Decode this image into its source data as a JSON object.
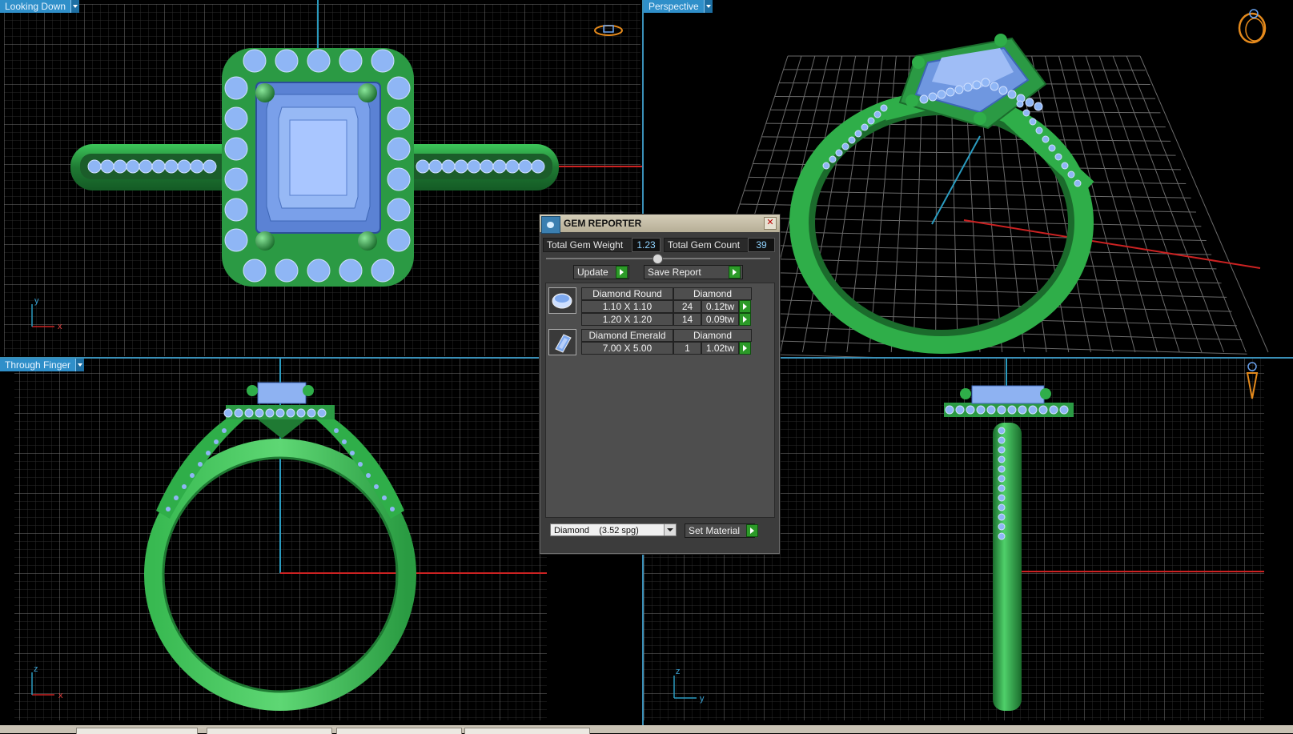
{
  "viewports": {
    "top_left": {
      "label": "Looking Down"
    },
    "top_right": {
      "label": "Perspective"
    },
    "bottom_left": {
      "label": "Through Finger"
    },
    "bottom_right": {
      "label": ""
    }
  },
  "axes": {
    "top_left": {
      "a": "y",
      "b": "x"
    },
    "bottom_left": {
      "a": "z",
      "b": "x"
    },
    "bottom_right": {
      "a": "z",
      "b": "y"
    }
  },
  "gem_reporter": {
    "title": "GEM REPORTER",
    "total_weight_label": "Total Gem Weight",
    "total_weight_value": "1.23",
    "total_count_label": "Total Gem Count",
    "total_count_value": "39",
    "update_label": "Update",
    "save_label": "Save Report",
    "groups": [
      {
        "name": "Diamond Round",
        "material": "Diamond",
        "rows": [
          {
            "size": "1.10 X 1.10",
            "count": "24",
            "weight": "0.12tw"
          },
          {
            "size": "1.20 X 1.20",
            "count": "14",
            "weight": "0.09tw"
          }
        ]
      },
      {
        "name": "Diamond Emerald",
        "material": "Diamond",
        "rows": [
          {
            "size": "7.00 X 5.00",
            "count": "1",
            "weight": "1.02tw"
          }
        ]
      }
    ],
    "material_select": "Diamond    (3.52 spg)",
    "set_material_label": "Set Material"
  },
  "colors": {
    "metal": "#2fae49",
    "gem": "#7ea9ef",
    "grid": "#6e6e6e",
    "accent": "#2f8fc9"
  }
}
